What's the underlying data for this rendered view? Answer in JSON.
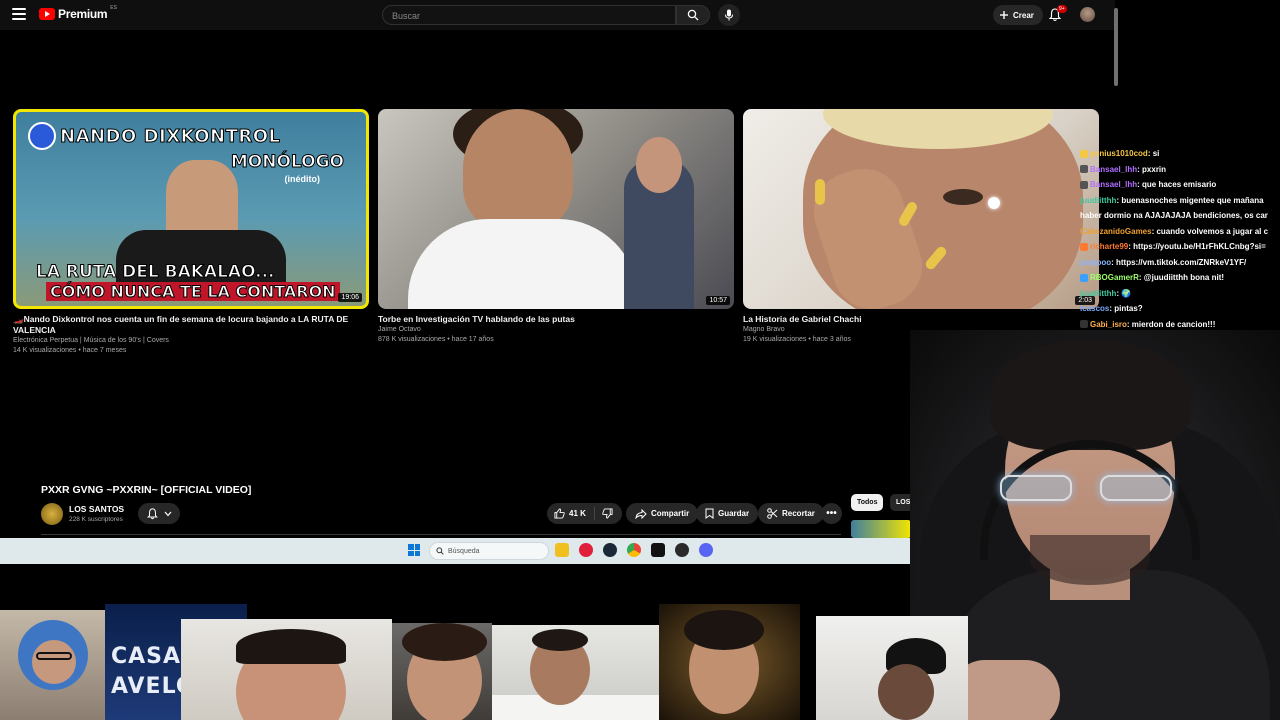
{
  "header": {
    "brand": "Premium",
    "region": "ES",
    "search_placeholder": "Buscar",
    "create_label": "Crear",
    "notifications_badge": "9+"
  },
  "videos": [
    {
      "title_line1": "🏎️Nando Dixkontrol nos cuenta un fin de semana de locura bajando a LA RUTA DE",
      "title_line2": "VALENCIA",
      "channel": "Electrónica Perpetua | Música de los 90's | Covers",
      "meta": "14 K visualizaciones • hace 7 meses",
      "duration": "19:06",
      "thumb_text": {
        "name": "NANDO DIXKONTROL",
        "monologo": "MONÓLOGO",
        "inedito": "(inédito)",
        "ruta": "LA RUTA DEL BAKALAO...",
        "como": "CÓMO NUNCA TE LA CONTARON"
      }
    },
    {
      "title_line1": "Torbe en Investigación TV hablando de las putas",
      "title_line2": "",
      "channel": "Jaime Octavo",
      "meta": "878 K visualizaciones • hace 17 años",
      "duration": "10:57"
    },
    {
      "title_line1": "La Historia de Gabriel Chachi",
      "title_line2": "",
      "channel": "Magno Bravo",
      "meta": "19 K visualizaciones • hace 3 años",
      "duration": "2:03"
    }
  ],
  "chat": [
    {
      "user": "genius1010cod",
      "msg": ": si",
      "color": "#f5c842"
    },
    {
      "user": "Bansael_lhh",
      "msg": ": pxxrin",
      "color": "#b070ff"
    },
    {
      "user": "Bansael_lhh",
      "msg": ": que haces emisario",
      "color": "#b070ff"
    },
    {
      "user": "juudiitthh",
      "msg": ": buenasnoches migentee que mañana",
      "color": "#40c8a0"
    },
    {
      "user": "",
      "msg": "haber dormio na AJAJAJAJA bendiciones, os car",
      "color": "#ffffff"
    },
    {
      "user": "CabezanidoGames",
      "msg": ": cuando volvemos a jugar al c",
      "color": "#f0a030"
    },
    {
      "user": "richarte99",
      "msg": ": https://youtu.be/H1rFhKLCnbg?si=",
      "color": "#ff7a30"
    },
    {
      "user": "panjooo",
      "msg": ": https://vm.tiktok.com/ZNRkeV1YF/",
      "color": "#8ab4ff"
    },
    {
      "user": "RBOGamerR",
      "msg": ": @juudiitthh bona nit!",
      "color": "#9cff6a"
    },
    {
      "user": "juudiitthh",
      "msg": ": 🌍",
      "color": "#40c8a0"
    },
    {
      "user": "lcascos",
      "msg": ": pintas?",
      "color": "#7aa8ff"
    },
    {
      "user": "Gabi_isro",
      "msg": ": mierdon de cancion!!!",
      "color": "#ffb050"
    }
  ],
  "player": {
    "title": "PXXR GVNG ~PXXRIN~ [OFFICIAL VIDEO]",
    "channel": "LOS SANTOS",
    "subscribers": "228 K suscriptores",
    "likes": "41 K",
    "share_label": "Compartir",
    "save_label": "Guardar",
    "clip_label": "Recortar",
    "more_label": "•••",
    "chip_all": "Todos",
    "chip_other": "LOS SANTOS"
  },
  "taskbar": {
    "search_placeholder": "Búsqueda"
  },
  "overlay": {
    "casa_text_1": "CASA D",
    "casa_text_2": "AVELO"
  },
  "colors": {
    "accent": "#ff0000",
    "background": "#0f0f0f",
    "taskbar": "#dfe9ec"
  }
}
